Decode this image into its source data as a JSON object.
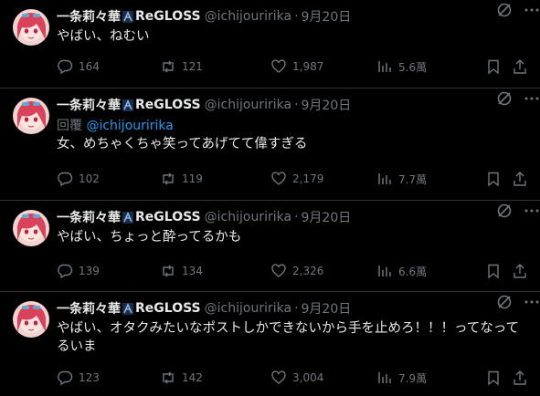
{
  "colors": {
    "background": "#000000",
    "text": "#e7e9ea",
    "muted": "#71767b",
    "link": "#1d9bf0",
    "divider": "#2f3336"
  },
  "author": {
    "name": "一条莉々華",
    "org": "ReGLOSS",
    "handle": "@ichijouririka",
    "dot": "·"
  },
  "tweets": [
    {
      "date": "9月20日",
      "reply_label": "",
      "reply_mention": "",
      "text": "やばい、ねむい",
      "replies": "164",
      "retweets": "121",
      "likes": "1,987",
      "views": "5.6萬"
    },
    {
      "date": "9月20日",
      "reply_label": "回覆",
      "reply_mention": "@ichijouririka",
      "text": "女、めちゃくちゃ笑ってあげてて偉すぎる",
      "replies": "102",
      "retweets": "119",
      "likes": "2,179",
      "views": "7.7萬"
    },
    {
      "date": "9月20日",
      "reply_label": "",
      "reply_mention": "",
      "text": "やばい、ちょっと酔ってるかも",
      "replies": "139",
      "retweets": "134",
      "likes": "2,326",
      "views": "6.6萬"
    },
    {
      "date": "9月20日",
      "reply_label": "",
      "reply_mention": "",
      "text": "やばい、オタクみたいなポストしかできないから手を止めろ！！！ってなってるいま",
      "replies": "123",
      "retweets": "142",
      "likes": "3,004",
      "views": "7.9萬"
    }
  ]
}
